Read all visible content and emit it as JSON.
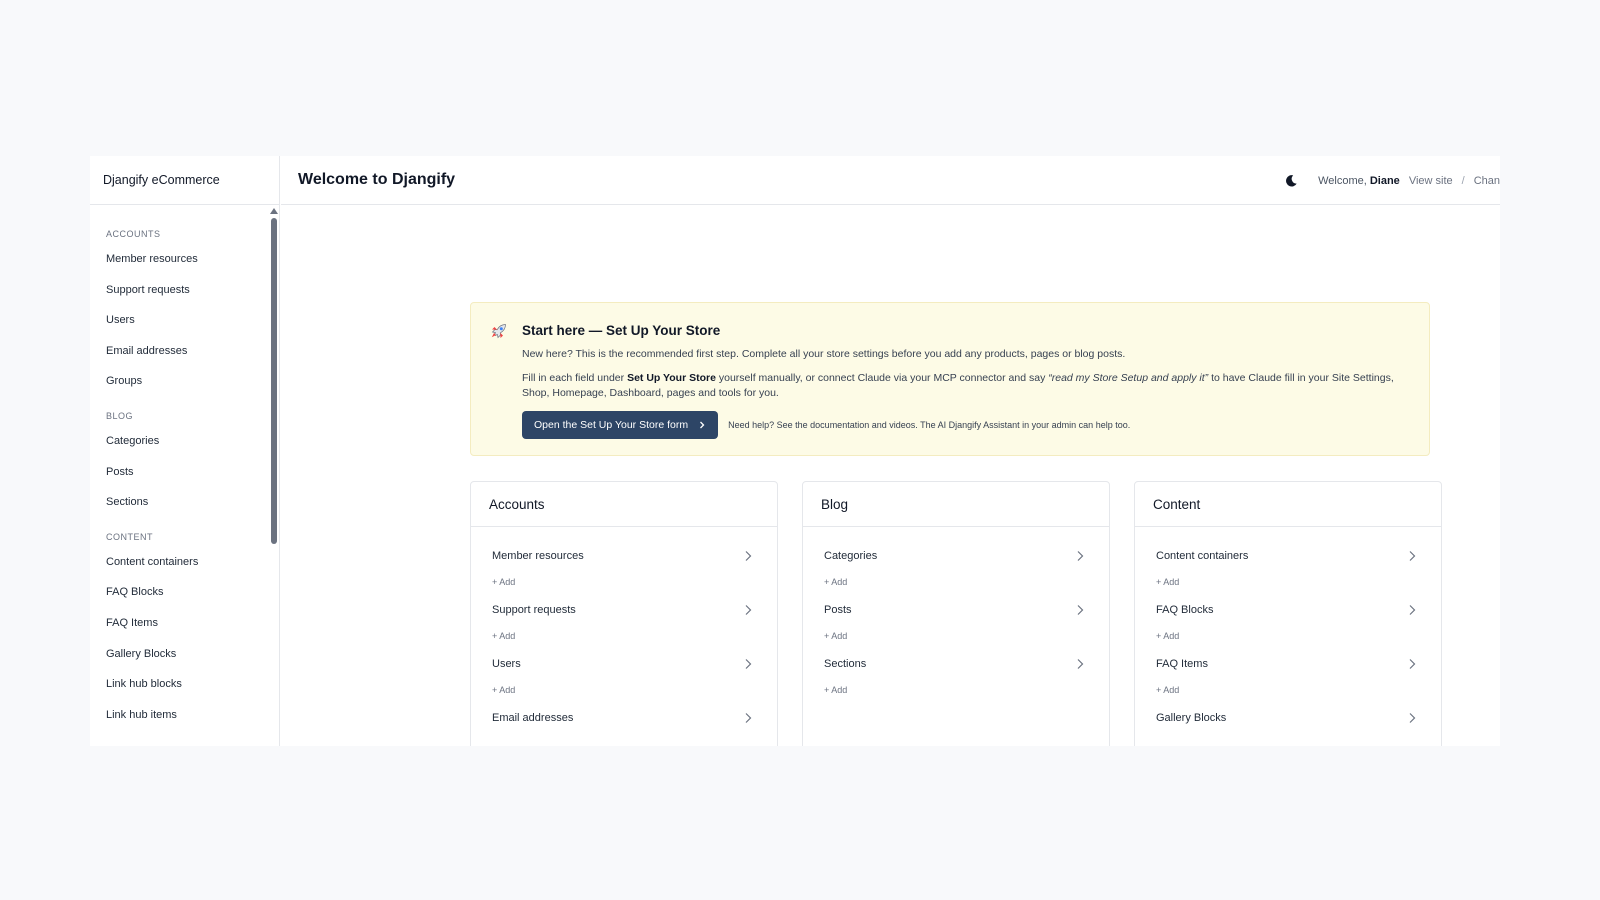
{
  "app": {
    "brand": "Djangify eCommerce"
  },
  "header": {
    "title": "Welcome to Djangify",
    "welcome_prefix": "Welcome, ",
    "user_name": "Diane",
    "view_site": "View site",
    "separator": "/",
    "change_password": "Chan"
  },
  "sidebar": {
    "sections": [
      {
        "title": "ACCOUNTS",
        "items": [
          "Member resources",
          "Support requests",
          "Users",
          "Email addresses",
          "Groups"
        ]
      },
      {
        "title": "BLOG",
        "items": [
          "Categories",
          "Posts",
          "Sections"
        ]
      },
      {
        "title": "CONTENT",
        "items": [
          "Content containers",
          "FAQ Blocks",
          "FAQ Items",
          "Gallery Blocks",
          "Link hub blocks",
          "Link hub items"
        ]
      }
    ]
  },
  "banner": {
    "title": "Start here — Set Up Your Store",
    "p1": "New here? This is the recommended first step. Complete all your store settings before you add any products, pages or blog posts.",
    "p2_a": "Fill in each field under ",
    "p2_b": "Set Up Your Store",
    "p2_c": " yourself manually, or connect Claude via your MCP connector and say ",
    "p2_d": "“read my Store Setup and apply it”",
    "p2_e": " to have Claude fill in your Site Settings, Shop, Homepage, Dashboard, pages and tools for you.",
    "cta": "Open the Set Up Your Store form",
    "help_a": "Need help? See the ",
    "help_doc": "documentation",
    "help_b": " and ",
    "help_videos": "videos",
    "help_c": ". The AI Djangify Assistant in your admin can help too."
  },
  "cards": [
    {
      "title": "Accounts",
      "items": [
        {
          "name": "Member resources",
          "add": "+ Add"
        },
        {
          "name": "Support requests",
          "add": "+ Add"
        },
        {
          "name": "Users",
          "add": "+ Add"
        },
        {
          "name": "Email addresses",
          "add": ""
        }
      ]
    },
    {
      "title": "Blog",
      "items": [
        {
          "name": "Categories",
          "add": "+ Add"
        },
        {
          "name": "Posts",
          "add": "+ Add"
        },
        {
          "name": "Sections",
          "add": "+ Add"
        }
      ]
    },
    {
      "title": "Content",
      "items": [
        {
          "name": "Content containers",
          "add": "+ Add"
        },
        {
          "name": "FAQ Blocks",
          "add": "+ Add"
        },
        {
          "name": "FAQ Items",
          "add": "+ Add"
        },
        {
          "name": "Gallery Blocks",
          "add": ""
        }
      ]
    }
  ],
  "colors": {
    "primary_button": "#2d4566",
    "banner_bg": "#fdfbe6",
    "page_bg": "#f8f9fb"
  },
  "icons": {
    "theme_toggle": "moon-icon",
    "banner": "rocket-icon",
    "row_arrow": "chevron-right-icon"
  }
}
